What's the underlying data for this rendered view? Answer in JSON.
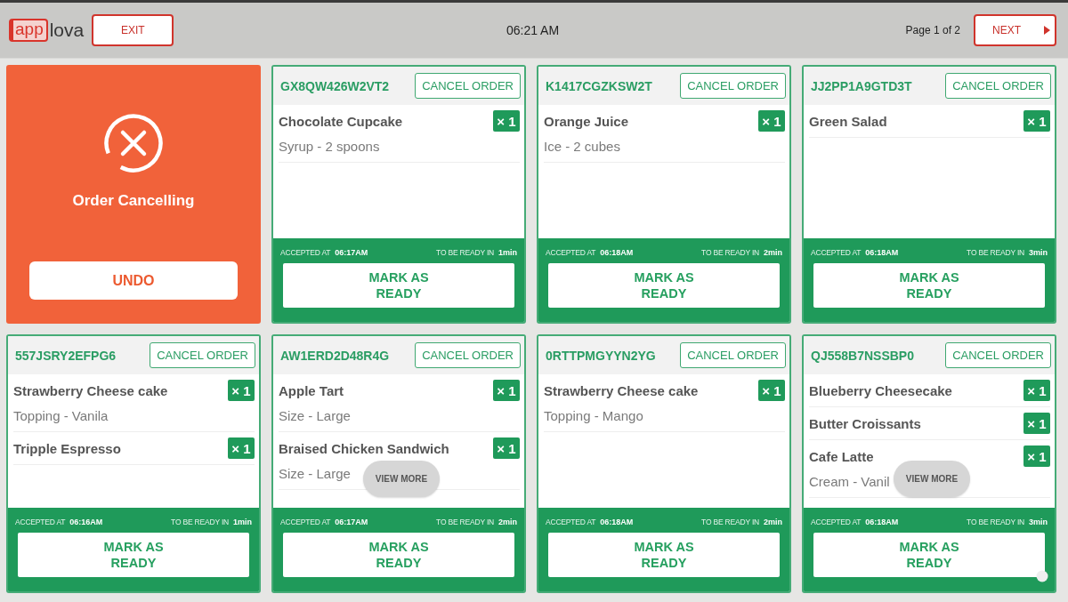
{
  "header": {
    "logo": {
      "boxed": "app",
      "plain": "lova"
    },
    "exit_button": "EXIT",
    "time": "06:21 AM",
    "page_indicator": "Page 1 of 2",
    "next_button": "NEXT"
  },
  "orders": [
    {
      "kind": "cancelling",
      "status": "Order Cancelling",
      "undo_button": "UNDO"
    },
    {
      "kind": "order",
      "order_id": "GX8QW426W2VT2",
      "cancel_button": "CANCEL ORDER",
      "items": [
        {
          "name": "Chocolate Cupcake",
          "quantity": "× 1",
          "modifier": "Syrup - 2 spoons"
        }
      ],
      "accepted_label": "ACCEPTED AT",
      "accepted_time": "06:17AM",
      "ready_label": "TO BE READY IN",
      "ready_time": "1min",
      "mark_ready_button": "MARK AS READY"
    },
    {
      "kind": "order",
      "order_id": "K1417CGZKSW2T",
      "cancel_button": "CANCEL ORDER",
      "items": [
        {
          "name": "Orange Juice",
          "quantity": "× 1",
          "modifier": "Ice - 2 cubes"
        }
      ],
      "accepted_label": "ACCEPTED AT",
      "accepted_time": "06:18AM",
      "ready_label": "TO BE READY IN",
      "ready_time": "2min",
      "mark_ready_button": "MARK AS READY"
    },
    {
      "kind": "order",
      "order_id": "JJ2PP1A9GTD3T",
      "cancel_button": "CANCEL ORDER",
      "items": [
        {
          "name": "Green Salad",
          "quantity": "× 1"
        }
      ],
      "accepted_label": "ACCEPTED AT",
      "accepted_time": "06:18AM",
      "ready_label": "TO BE READY IN",
      "ready_time": "3min",
      "mark_ready_button": "MARK AS READY"
    },
    {
      "kind": "order",
      "order_id": "557JSRY2EFPG6",
      "cancel_button": "CANCEL ORDER",
      "items": [
        {
          "name": "Strawberry Cheese cake",
          "quantity": "× 1",
          "modifier": "Topping - Vanila"
        },
        {
          "name": "Tripple Espresso",
          "quantity": "× 1"
        }
      ],
      "accepted_label": "ACCEPTED AT",
      "accepted_time": "06:16AM",
      "ready_label": "TO BE READY IN",
      "ready_time": "1min",
      "mark_ready_button": "MARK AS READY"
    },
    {
      "kind": "order",
      "order_id": "AW1ERD2D48R4G",
      "cancel_button": "CANCEL ORDER",
      "items": [
        {
          "name": "Apple Tart",
          "quantity": "× 1",
          "modifier": "Size - Large"
        },
        {
          "name": "Braised Chicken Sandwich",
          "quantity": "× 1",
          "modifier": "Size - Large"
        }
      ],
      "view_more": "VIEW MORE",
      "accepted_label": "ACCEPTED AT",
      "accepted_time": "06:17AM",
      "ready_label": "TO BE READY IN",
      "ready_time": "2min",
      "mark_ready_button": "MARK AS READY"
    },
    {
      "kind": "order",
      "order_id": "0RTTPMGYYN2YG",
      "cancel_button": "CANCEL ORDER",
      "items": [
        {
          "name": "Strawberry Cheese cake",
          "quantity": "× 1",
          "modifier": "Topping - Mango"
        }
      ],
      "accepted_label": "ACCEPTED AT",
      "accepted_time": "06:18AM",
      "ready_label": "TO BE READY IN",
      "ready_time": "2min",
      "mark_ready_button": "MARK AS READY"
    },
    {
      "kind": "order",
      "order_id": "QJ558B7NSSBP0",
      "cancel_button": "CANCEL ORDER",
      "items": [
        {
          "name": "Blueberry Cheesecake",
          "quantity": "× 1"
        },
        {
          "name": "Butter Croissants",
          "quantity": "× 1"
        },
        {
          "name": "Cafe Latte",
          "quantity": "× 1",
          "modifier": "Cream - Vanil"
        }
      ],
      "view_more": "VIEW MORE",
      "accepted_label": "ACCEPTED AT",
      "accepted_time": "06:18AM",
      "ready_label": "TO BE READY IN",
      "ready_time": "3min",
      "mark_ready_button": "MARK AS READY"
    }
  ]
}
